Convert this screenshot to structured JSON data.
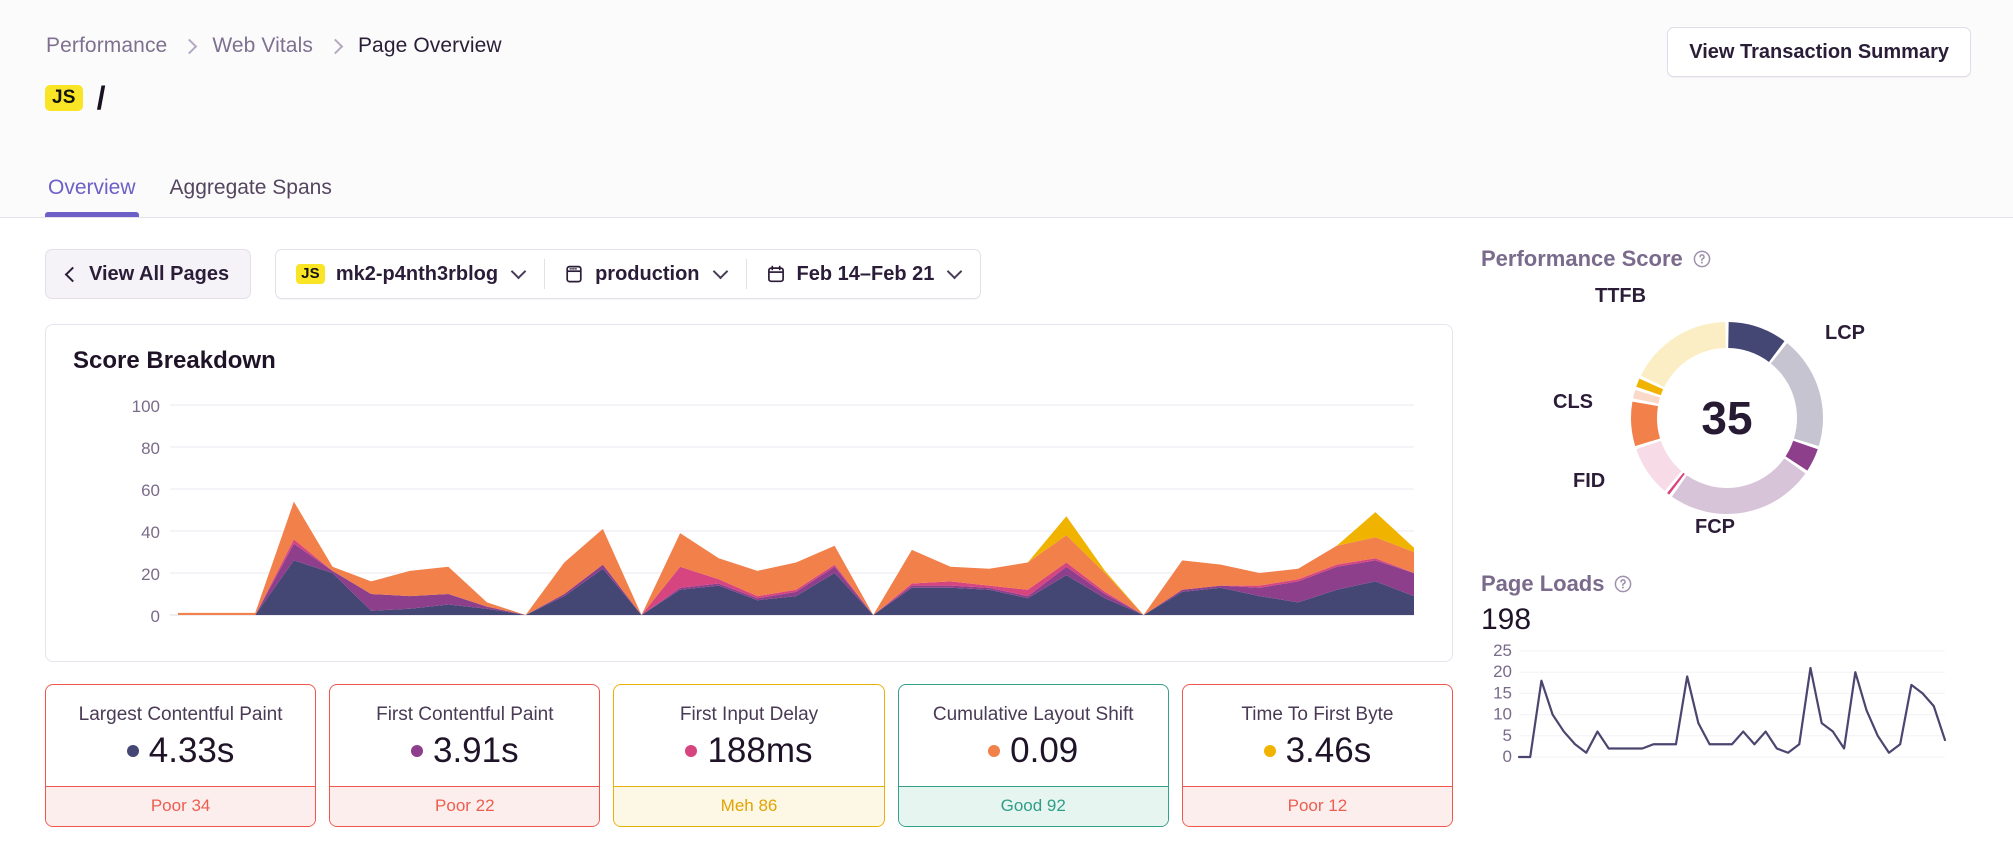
{
  "breadcrumb": [
    {
      "label": "Performance",
      "current": false
    },
    {
      "label": "Web Vitals",
      "current": false
    },
    {
      "label": "Page Overview",
      "current": true
    }
  ],
  "header": {
    "badge": "JS",
    "title": "/",
    "view_transaction_summary": "View Transaction Summary"
  },
  "tabs": [
    {
      "label": "Overview",
      "active": true
    },
    {
      "label": "Aggregate Spans",
      "active": false
    }
  ],
  "filters": {
    "view_all_pages": "View All Pages",
    "project_badge": "JS",
    "project": "mk2-p4nth3rblog",
    "environment": "production",
    "date_range": "Feb 14–Feb 21"
  },
  "score_breakdown": {
    "title": "Score Breakdown"
  },
  "vitals": [
    {
      "label": "Largest Contentful Paint",
      "value": "4.33s",
      "dot_color": "#444674",
      "status": "Poor 34",
      "tone": "poor"
    },
    {
      "label": "First Contentful Paint",
      "value": "3.91s",
      "dot_color": "#8d3f8c",
      "status": "Poor 22",
      "tone": "poor"
    },
    {
      "label": "First Input Delay",
      "value": "188ms",
      "dot_color": "#d6457f",
      "status": "Meh 86",
      "tone": "meh"
    },
    {
      "label": "Cumulative Layout Shift",
      "value": "0.09",
      "dot_color": "#f1804a",
      "status": "Good 92",
      "tone": "good"
    },
    {
      "label": "Time To First Byte",
      "value": "3.46s",
      "dot_color": "#f0b400",
      "status": "Poor 12",
      "tone": "poor"
    }
  ],
  "performance_score": {
    "title": "Performance Score",
    "score": "35",
    "labels": {
      "lcp": "LCP",
      "fcp": "FCP",
      "fid": "FID",
      "cls": "CLS",
      "ttfb": "TTFB"
    }
  },
  "page_loads": {
    "title": "Page Loads",
    "count": "198"
  },
  "colors": {
    "accent": "#6c5fc7",
    "lcp_dark": "#444674",
    "lcp_light": "#c7c4d1",
    "fcp_dark": "#8d3f8c",
    "fcp_light": "#d8c4d8",
    "fid_dark": "#d6457f",
    "fid_light": "#f7dbe6",
    "cls_dark": "#f1804a",
    "cls_light": "#fbd9c8",
    "ttfb_dark": "#f0b400",
    "ttfb_light": "#fbeec4",
    "line": "#4b466f",
    "badge_yellow": "#f9e526"
  },
  "chart_data": [
    {
      "type": "area",
      "title": "Score Breakdown",
      "stacked": true,
      "ylabel": "",
      "xlabel": "",
      "ylim": [
        0,
        100
      ],
      "yticks": [
        0,
        20,
        40,
        60,
        80,
        100
      ],
      "grid": true,
      "x": [
        0,
        1,
        2,
        3,
        4,
        5,
        6,
        7,
        8,
        9,
        10,
        11,
        12,
        13,
        14,
        15,
        16,
        17,
        18,
        19,
        20,
        21,
        22,
        23,
        24,
        25,
        26,
        27,
        28,
        29,
        30,
        31,
        32
      ],
      "series": [
        {
          "name": "LCP",
          "color": "#444674",
          "values": [
            0,
            0,
            0,
            26,
            20,
            2,
            3,
            5,
            3,
            0,
            9,
            22,
            0,
            12,
            14,
            7,
            9,
            20,
            0,
            13,
            13,
            12,
            8,
            19,
            8,
            0,
            11,
            13,
            9,
            6,
            12,
            16,
            9
          ]
        },
        {
          "name": "FCP",
          "color": "#8d3f8c",
          "values": [
            0,
            0,
            0,
            8,
            1,
            8,
            6,
            5,
            1,
            0,
            1,
            2,
            0,
            1,
            1,
            1,
            2,
            3,
            0,
            1,
            1,
            1,
            1,
            4,
            2,
            0,
            1,
            1,
            4,
            10,
            11,
            10,
            11
          ]
        },
        {
          "name": "FID",
          "color": "#d6457f",
          "values": [
            0,
            0,
            0,
            2,
            0,
            0,
            0,
            0,
            0,
            0,
            0,
            0,
            0,
            10,
            2,
            1,
            1,
            1,
            0,
            1,
            2,
            1,
            3,
            2,
            1,
            0,
            0,
            0,
            1,
            1,
            1,
            1,
            0
          ]
        },
        {
          "name": "CLS",
          "color": "#f1804a",
          "values": [
            1,
            1,
            1,
            18,
            2,
            6,
            12,
            13,
            2,
            0,
            15,
            17,
            0,
            16,
            10,
            12,
            13,
            9,
            0,
            16,
            7,
            8,
            13,
            13,
            9,
            0,
            14,
            10,
            6,
            5,
            9,
            10,
            10
          ]
        },
        {
          "name": "TTFB",
          "color": "#f0b400",
          "values": [
            0,
            0,
            0,
            0,
            0,
            0,
            0,
            0,
            0,
            0,
            0,
            0,
            0,
            0,
            0,
            0,
            0,
            0,
            0,
            0,
            0,
            0,
            0,
            9,
            1,
            0,
            0,
            0,
            0,
            0,
            0,
            12,
            2
          ]
        }
      ]
    },
    {
      "type": "pie",
      "title": "Performance Score",
      "center_value": "35",
      "labels": [
        "LCP",
        "LCP-rest",
        "FCP",
        "FCP-rest",
        "FID",
        "FID-rest",
        "CLS",
        "CLS-rest",
        "TTFB",
        "TTFB-rest"
      ],
      "values": [
        10.5,
        19.5,
        4.5,
        25.5,
        1.0,
        9.0,
        8.0,
        2.0,
        2.0,
        18.0
      ],
      "colors": [
        "#444674",
        "#c7c4d1",
        "#8d3f8c",
        "#d8c4d8",
        "#d6457f",
        "#f7dbe6",
        "#f1804a",
        "#fbd9c8",
        "#f0b400",
        "#fbeec4"
      ]
    },
    {
      "type": "line",
      "title": "Page Loads",
      "ylim": [
        0,
        25
      ],
      "yticks": [
        0,
        5,
        10,
        15,
        20,
        25
      ],
      "grid": true,
      "color": "#4b466f",
      "x": [
        0,
        1,
        2,
        3,
        4,
        5,
        6,
        7,
        8,
        9,
        10,
        11,
        12,
        13,
        14,
        15,
        16,
        17,
        18,
        19,
        20,
        21,
        22,
        23,
        24,
        25,
        26,
        27,
        28,
        29,
        30,
        31,
        32,
        33,
        34,
        35,
        36,
        37,
        38
      ],
      "values": [
        0,
        0,
        18,
        10,
        6,
        3,
        1,
        6,
        2,
        2,
        2,
        2,
        3,
        3,
        3,
        19,
        8,
        3,
        3,
        3,
        6,
        3,
        6,
        2,
        1,
        3,
        21,
        8,
        6,
        2,
        20,
        11,
        5,
        1,
        3,
        17,
        15,
        12,
        4
      ]
    }
  ]
}
